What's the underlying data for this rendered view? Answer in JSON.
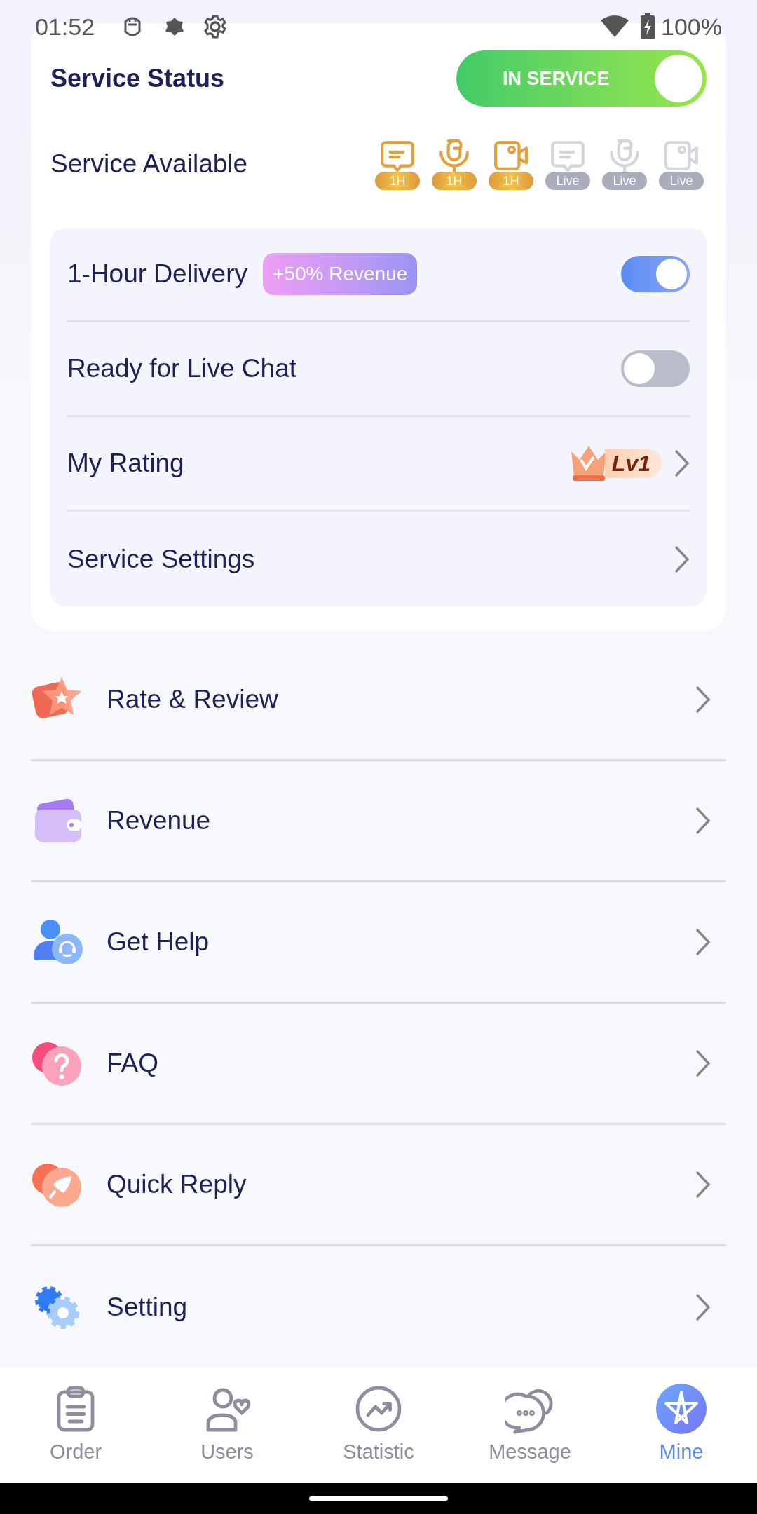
{
  "status_bar": {
    "time": "01:52",
    "battery": "100%"
  },
  "service_card": {
    "title": "Service Status",
    "status_toggle": {
      "label": "IN SERVICE",
      "on": true
    },
    "available_label": "Service Available",
    "services": [
      {
        "kind": "chat",
        "badge": "1H",
        "active": true
      },
      {
        "kind": "mic",
        "badge": "1H",
        "active": true
      },
      {
        "kind": "video",
        "badge": "1H",
        "active": true
      },
      {
        "kind": "chat",
        "badge": "Live",
        "active": false
      },
      {
        "kind": "mic",
        "badge": "Live",
        "active": false
      },
      {
        "kind": "video",
        "badge": "Live",
        "active": false
      }
    ],
    "settings": [
      {
        "kind": "toggle",
        "label": "1-Hour Delivery",
        "tag": "+50% Revenue",
        "on": true
      },
      {
        "kind": "toggle",
        "label": "Ready for Live Chat",
        "on": false
      },
      {
        "kind": "rating",
        "label": "My Rating",
        "level_text": "Lv1"
      },
      {
        "kind": "link",
        "label": "Service Settings"
      }
    ]
  },
  "menu": [
    {
      "kind": "star",
      "label": "Rate & Review"
    },
    {
      "kind": "wallet",
      "label": "Revenue"
    },
    {
      "kind": "support",
      "label": "Get Help"
    },
    {
      "kind": "faq",
      "label": "FAQ"
    },
    {
      "kind": "rocket",
      "label": "Quick Reply"
    },
    {
      "kind": "gear",
      "label": "Setting"
    }
  ],
  "bottom_nav": [
    {
      "kind": "order",
      "label": "Order",
      "selected": false
    },
    {
      "kind": "users",
      "label": "Users",
      "selected": false
    },
    {
      "kind": "statistic",
      "label": "Statistic",
      "selected": false
    },
    {
      "kind": "message",
      "label": "Message",
      "selected": false
    },
    {
      "kind": "mine",
      "label": "Mine",
      "selected": true
    }
  ]
}
